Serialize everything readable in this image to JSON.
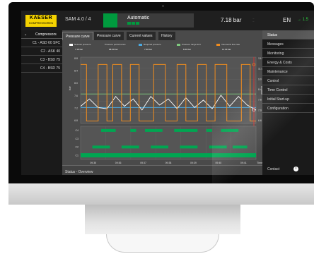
{
  "topbar": {
    "brand_line1": "KAESER",
    "brand_line2": "KOMPRESSOREN",
    "system": "SAM 4.0 / 4",
    "mode": "Automatic",
    "pressure": "7.18 bar",
    "mini_line1": "...",
    "mini_line2": "...",
    "language": "EN",
    "level": "→ 1.5"
  },
  "left_sidebar": {
    "header": "Compressors",
    "items": [
      {
        "label": "C1 - ASD 60 SFC"
      },
      {
        "label": "C2 - ASK 40"
      },
      {
        "label": "C3 - BSD 75"
      },
      {
        "label": "C4 - BSD 75"
      }
    ]
  },
  "tabs": [
    {
      "label": "Pressure curve",
      "active": true
    },
    {
      "label": "Pressure curve",
      "active": false
    },
    {
      "label": "Current values",
      "active": false
    },
    {
      "label": "History",
      "active": false
    }
  ],
  "legend": [
    {
      "label": "Network pressure",
      "value": "7.18 bar",
      "color": "#ffffff"
    },
    {
      "label": "Pressure performance",
      "value": "98.00 bar",
      "color": "#ffffff"
    },
    {
      "label": "Required pressure",
      "value": "7.30 bar",
      "color": "#4aa8e0"
    },
    {
      "label": "Pressure range limit",
      "value": "8.40 bar",
      "color": "#7fc97f"
    },
    {
      "label": "Volumetric flow rate",
      "value": "11.40 bar",
      "color": "#f08c1e"
    }
  ],
  "chart_data": [
    {
      "type": "line",
      "series": [
        {
          "name": "Network pressure",
          "color": "#ffffff",
          "x": [
            0,
            3,
            6,
            9,
            12,
            15,
            18,
            21,
            24,
            27,
            30,
            33,
            36,
            39,
            42,
            45,
            48,
            51,
            54,
            57,
            60
          ],
          "values": [
            7.4,
            8.0,
            7.3,
            7.2,
            8.2,
            7.4,
            8.0,
            7.1,
            8.2,
            7.5,
            8.0,
            7.2,
            8.1,
            7.3,
            7.9,
            7.2,
            8.3,
            7.4,
            8.2,
            7.5,
            7.1
          ]
        },
        {
          "name": "Volumetric flow rate",
          "color": "#f08c1e",
          "x": [
            0,
            2,
            2,
            6,
            6,
            9,
            9,
            11,
            11,
            14,
            14,
            17,
            17,
            20,
            20,
            25,
            25,
            29,
            29,
            33,
            33,
            36,
            36,
            40,
            40,
            43,
            43,
            46,
            46,
            50,
            50,
            55,
            55,
            58,
            58,
            60
          ],
          "values": [
            10.8,
            10.8,
            6.2,
            6.2,
            10.8,
            10.8,
            6.2,
            6.2,
            10.8,
            10.8,
            6.2,
            6.2,
            10.8,
            10.8,
            6.2,
            6.2,
            10.8,
            10.8,
            6.2,
            6.2,
            10.8,
            10.8,
            6.2,
            6.2,
            10.8,
            10.8,
            6.2,
            6.2,
            10.8,
            10.8,
            6.2,
            6.2,
            10.8,
            10.8,
            6.2,
            6.2
          ]
        }
      ],
      "hlines": [
        {
          "name": "Required pressure",
          "color": "#4aa8e0",
          "value": 7.3
        },
        {
          "name": "Pressure range limit",
          "color": "#7fc97f",
          "value": 8.4
        }
      ],
      "y_left_ticks": [
        "8.8",
        "8.4",
        "8.0",
        "7.6",
        "7.2",
        "6.8"
      ],
      "y_right_ticks": [
        "13.0",
        "11.0",
        "9.0",
        "8.4",
        "7.6",
        "7.0",
        "6.6"
      ],
      "ylabel_left": "bar",
      "ylabel_right": "m³/min",
      "xlim": [
        0,
        60
      ]
    },
    {
      "type": "bar",
      "row_labels": [
        "C1",
        "C2",
        "C3",
        "C4"
      ],
      "x_tick_labels": [
        "09:35",
        "09:36",
        "09:37",
        "09:38",
        "09:39",
        "09:40",
        "09:41"
      ],
      "xlabel": "Time",
      "color": "#00a651",
      "xlim": [
        0,
        60
      ],
      "segments": [
        {
          "row": 0,
          "start": 0,
          "end": 60
        },
        {
          "row": 1,
          "start": 4,
          "end": 10
        },
        {
          "row": 1,
          "start": 14,
          "end": 20
        },
        {
          "row": 1,
          "start": 24,
          "end": 30
        },
        {
          "row": 1,
          "start": 34,
          "end": 40
        },
        {
          "row": 1,
          "start": 44,
          "end": 50
        },
        {
          "row": 1,
          "start": 52,
          "end": 57
        },
        {
          "row": 3,
          "start": 7,
          "end": 12
        },
        {
          "row": 3,
          "start": 17,
          "end": 19
        },
        {
          "row": 3,
          "start": 22,
          "end": 28
        },
        {
          "row": 3,
          "start": 32,
          "end": 40
        },
        {
          "row": 3,
          "start": 43,
          "end": 45
        },
        {
          "row": 3,
          "start": 48,
          "end": 54
        }
      ]
    }
  ],
  "status_bar": {
    "label": "Status - Overview"
  },
  "right_sidebar": {
    "items": [
      {
        "label": "Status",
        "selected": true
      },
      {
        "label": "Messages",
        "selected": false
      },
      {
        "label": "Monitoring",
        "selected": false
      },
      {
        "label": "Energy & Costs",
        "selected": false
      },
      {
        "label": "Maintenance",
        "selected": false
      },
      {
        "label": "Control",
        "selected": false
      },
      {
        "label": "Time Control",
        "selected": false
      },
      {
        "label": "Initial Start-up",
        "selected": false
      },
      {
        "label": "Configuration",
        "selected": false
      }
    ],
    "contact": "Contact",
    "info_glyph": "i"
  }
}
